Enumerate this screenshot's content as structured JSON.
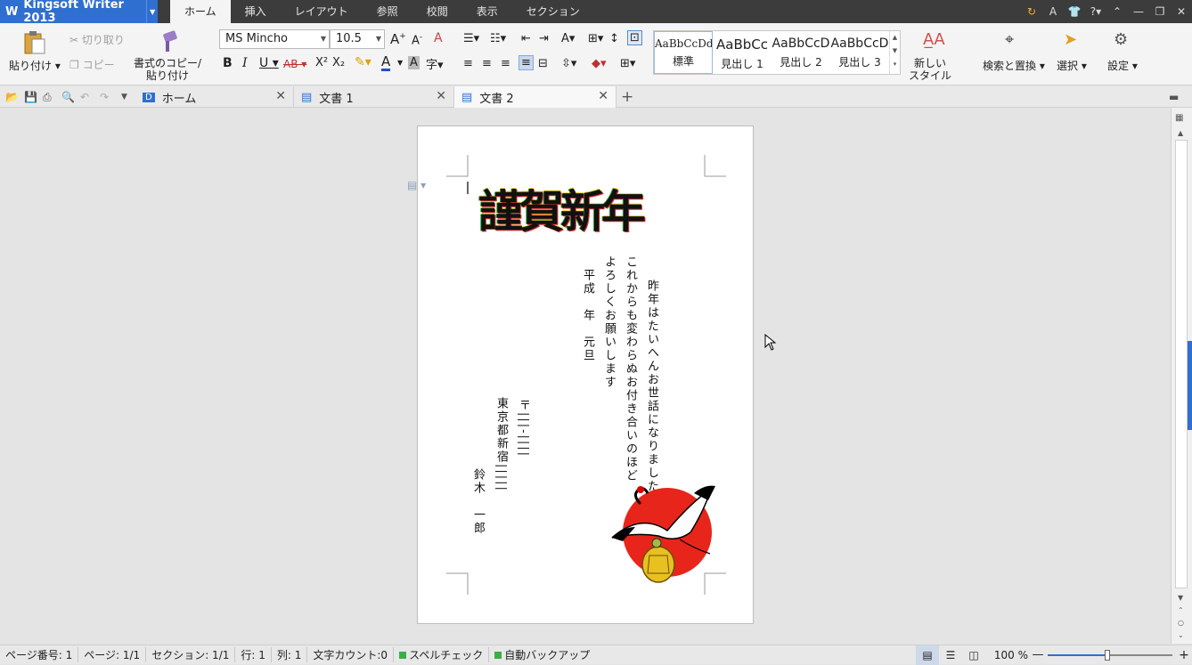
{
  "app": {
    "title": "Kingsoft Writer 2013"
  },
  "menu": [
    "ホーム",
    "挿入",
    "レイアウト",
    "参照",
    "校閲",
    "表示",
    "セクション"
  ],
  "ribbon": {
    "paste": "貼り付け",
    "cut": "切り取り",
    "copy": "コピー",
    "format_painter_1": "書式のコピー/",
    "format_painter_2": "貼り付け",
    "font_name": "MS Mincho",
    "font_size": "10.5",
    "styles": [
      {
        "sample": "AaBbCcDd",
        "label": "標準"
      },
      {
        "sample": "AaBbCc",
        "label": "見出し 1"
      },
      {
        "sample": "AaBbCcD",
        "label": "見出し 2"
      },
      {
        "sample": "AaBbCcD",
        "label": "見出し 3"
      }
    ],
    "new_style_1": "新しい",
    "new_style_2": "スタイル",
    "find_replace": "検索と置換",
    "select": "選択",
    "settings": "設定"
  },
  "tabs": [
    {
      "label": "ホーム"
    },
    {
      "label": "文書 1"
    },
    {
      "label": "文書 2"
    }
  ],
  "doc": {
    "title_art": "謹賀新年",
    "line1": "昨年はたいへんお世話になりました",
    "line2": "これからも変わらぬお付き合いのほど",
    "line3": "よろしくお願いします",
    "date": "平成　年　元旦",
    "postal": "〒|||-||||",
    "address": "東京都新宿|||||",
    "name": "鈴木　一郎"
  },
  "status": {
    "page_no": "ページ番号: 1",
    "page": "ページ: 1/1",
    "section": "セクション: 1/1",
    "row": "行: 1",
    "col": "列: 1",
    "chars": "文字カウント:0",
    "spell": "スペルチェック",
    "backup": "自動バックアップ",
    "zoom": "100 %"
  },
  "colors": {
    "accent": "#2f6fd0",
    "titlebar": "#3c3c3c",
    "sun": "#e8251a"
  }
}
